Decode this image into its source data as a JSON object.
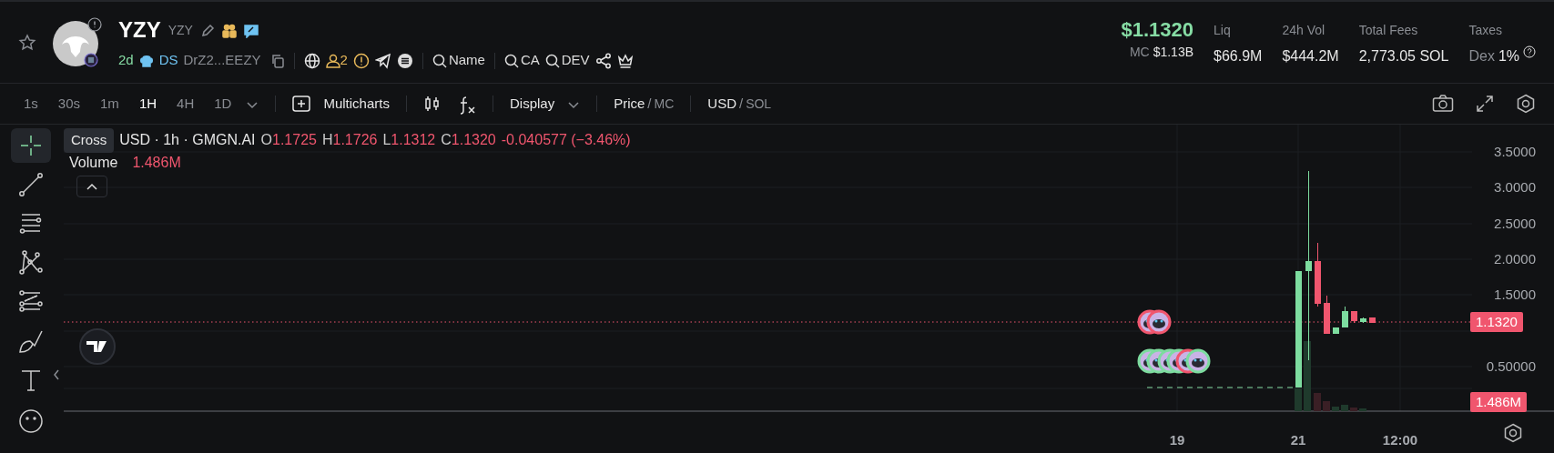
{
  "header": {
    "favorite": false,
    "name": "YZY",
    "symbol": "YZY",
    "age": "2d",
    "ds_label": "DS",
    "address": "DrZ2...EEZY",
    "holders_count": "2",
    "search_links": [
      "Name",
      "CA",
      "DEV"
    ]
  },
  "price": {
    "value": "$1.1320",
    "mc_label": "MC",
    "mc_value": "$1.13B"
  },
  "stats": [
    {
      "label": "Liq",
      "value": "$66.9M"
    },
    {
      "label": "24h Vol",
      "value": "$444.2M"
    },
    {
      "label": "Total Fees",
      "value": "2,773.05 SOL"
    },
    {
      "label": "Taxes",
      "kind": "tax",
      "prefix": "Dex",
      "value": "1%"
    }
  ],
  "timeframes": [
    {
      "label": "1s",
      "selected": false
    },
    {
      "label": "30s",
      "selected": false
    },
    {
      "label": "1m",
      "selected": false
    },
    {
      "label": "1H",
      "selected": true
    },
    {
      "label": "4H",
      "selected": false
    },
    {
      "label": "1D",
      "selected": false
    }
  ],
  "toolbar": {
    "multicharts": "Multicharts",
    "display": "Display",
    "separator": "/",
    "price_mode": [
      {
        "label": "Price",
        "selected": true
      },
      {
        "label": "MC",
        "selected": false
      }
    ],
    "currency": [
      {
        "label": "USD",
        "selected": true
      },
      {
        "label": "SOL",
        "selected": false
      }
    ]
  },
  "legend": {
    "title": "USD · 1h · GMGN.AI",
    "ohlc": [
      {
        "key": "O",
        "value": "1.1725"
      },
      {
        "key": "H",
        "value": "1.1726"
      },
      {
        "key": "L",
        "value": "1.1312"
      },
      {
        "key": "C",
        "value": "1.1320"
      }
    ],
    "change": "-0.040577 (−3.46%)",
    "volume_label": "Volume",
    "volume_value": "1.486M"
  },
  "tooltip": "Cross",
  "tools": [
    {
      "kind": "cross",
      "selected": true
    },
    {
      "kind": "line",
      "selected": false
    },
    {
      "kind": "hlines",
      "selected": false
    },
    {
      "kind": "pattern",
      "selected": false
    },
    {
      "kind": "fib",
      "selected": false
    },
    {
      "kind": "brush",
      "selected": false
    },
    {
      "kind": "text",
      "selected": false
    },
    {
      "kind": "emoji",
      "selected": false
    }
  ],
  "price_axis": [
    "3.5000",
    "3.0000",
    "2.5000",
    "2.0000",
    "1.5000",
    "0.50000"
  ],
  "price_tag": "1.1320",
  "volume_tag": "1.486M",
  "time_axis": [
    "19",
    "21",
    "12:00"
  ]
}
